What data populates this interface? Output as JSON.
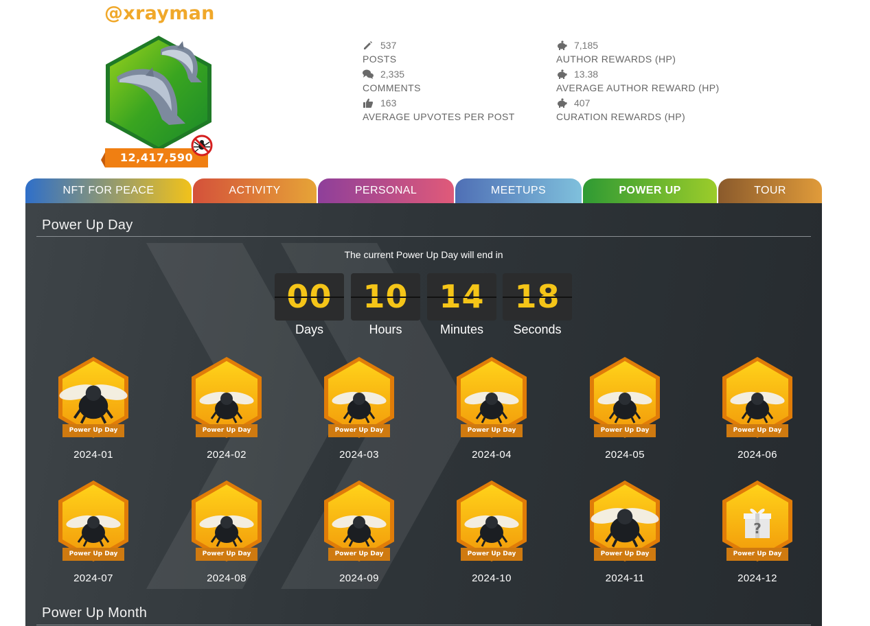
{
  "profile": {
    "username": "@xrayman",
    "score": "12,417,590"
  },
  "stats": {
    "posts": {
      "value": "537",
      "label": "POSTS",
      "icon": "pencil-icon"
    },
    "comments": {
      "value": "2,335",
      "label": "COMMENTS",
      "icon": "comments-icon"
    },
    "upvotes": {
      "value": "163",
      "label": "AVERAGE UPVOTES PER POST",
      "icon": "thumbs-up-icon"
    },
    "author_rewards": {
      "value": "7,185",
      "label": "AUTHOR REWARDS (HP)",
      "icon": "piggy-bank-icon"
    },
    "avg_author_reward": {
      "value": "13.38",
      "label": "AVERAGE AUTHOR REWARD (HP)",
      "icon": "piggy-bank-icon"
    },
    "curation_rewards": {
      "value": "407",
      "label": "CURATION REWARDS (HP)",
      "icon": "piggy-bank-icon"
    }
  },
  "tabs": [
    {
      "label": "NFT FOR PEACE",
      "color_from": "#2f6fc9",
      "color_to": "#f1c21b"
    },
    {
      "label": "ACTIVITY",
      "color_from": "#d4513a",
      "color_to": "#e6a437"
    },
    {
      "label": "PERSONAL",
      "color_from": "#8e3f9a",
      "color_to": "#e05a79"
    },
    {
      "label": "MEETUPS",
      "color_from": "#4f6fb5",
      "color_to": "#7fc0dc"
    },
    {
      "label": "POWER UP",
      "color_from": "#2f9a34",
      "color_to": "#9ccc2a"
    },
    {
      "label": "TOUR",
      "color_from": "#8a5a2c",
      "color_to": "#e09b3a"
    }
  ],
  "power_up_day": {
    "title": "Power Up Day",
    "caption": "The current Power Up Day will end in",
    "countdown": [
      {
        "value": "00",
        "label": "Days"
      },
      {
        "value": "10",
        "label": "Hours"
      },
      {
        "value": "14",
        "label": "Minutes"
      },
      {
        "value": "18",
        "label": "Seconds"
      }
    ],
    "badge_label": "Power Up Day",
    "badges": [
      {
        "date": "2024-01",
        "type": "big-bee"
      },
      {
        "date": "2024-02",
        "type": "bee"
      },
      {
        "date": "2024-03",
        "type": "bee"
      },
      {
        "date": "2024-04",
        "type": "bee"
      },
      {
        "date": "2024-05",
        "type": "bee"
      },
      {
        "date": "2024-06",
        "type": "bee"
      },
      {
        "date": "2024-07",
        "type": "bee"
      },
      {
        "date": "2024-08",
        "type": "bee"
      },
      {
        "date": "2024-09",
        "type": "bee"
      },
      {
        "date": "2024-10",
        "type": "bee"
      },
      {
        "date": "2024-11",
        "type": "big-bee"
      },
      {
        "date": "2024-12",
        "type": "gift"
      }
    ]
  },
  "power_up_month": {
    "title": "Power Up Month"
  },
  "colors": {
    "username": "#f0a82a",
    "digit": "#f5c518",
    "score_ribbon": "#f07f12"
  }
}
